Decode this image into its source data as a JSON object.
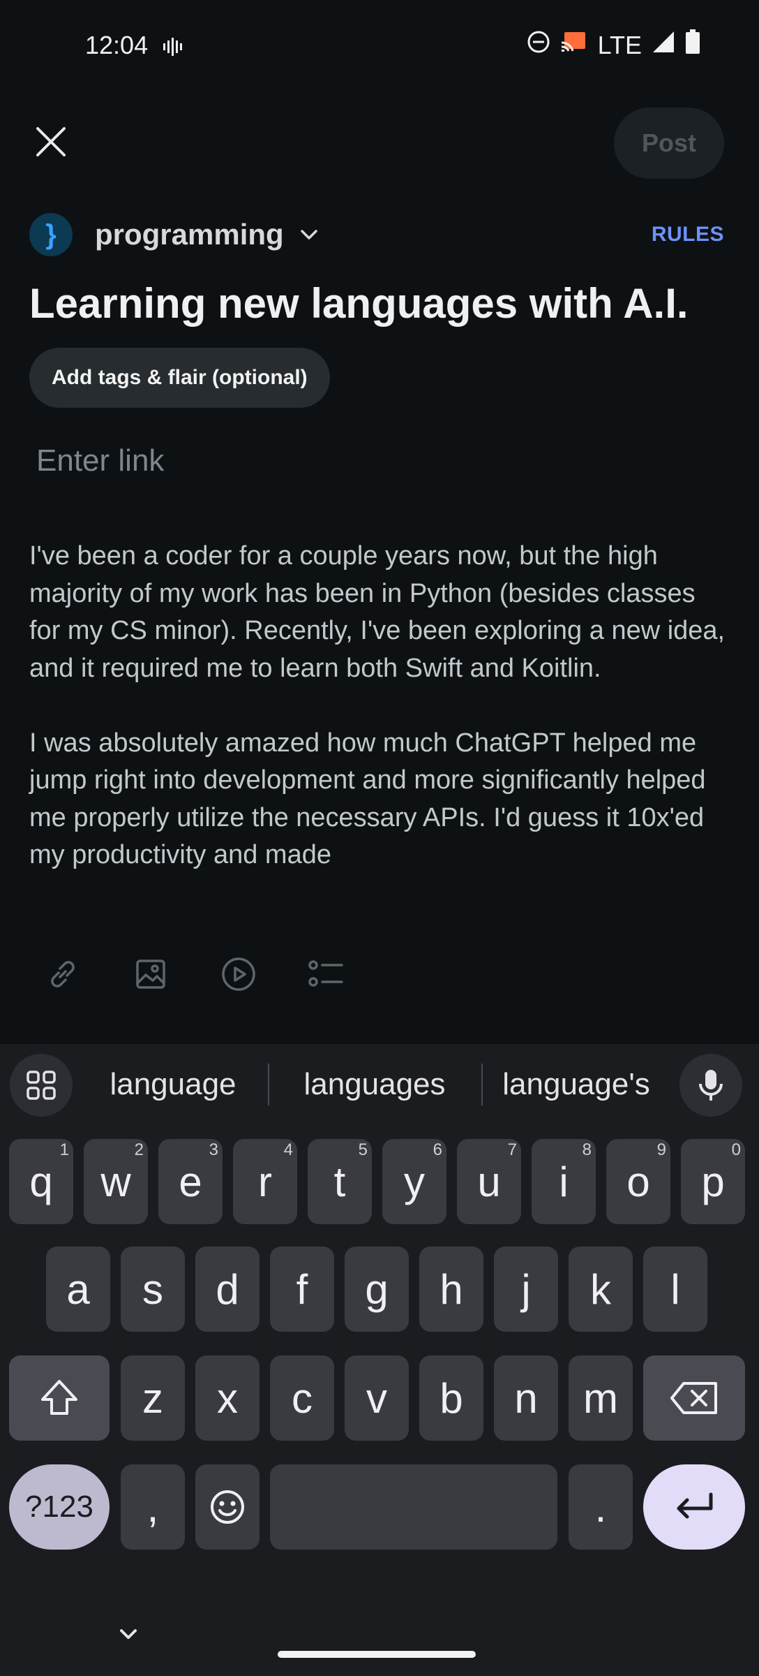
{
  "status_bar": {
    "time": "12:04",
    "network": "LTE",
    "icons": [
      "voicemail-icon",
      "do-not-disturb-icon",
      "cast-icon",
      "signal-icon",
      "battery-icon"
    ]
  },
  "header": {
    "close_icon": "close-icon",
    "post_label": "Post"
  },
  "community": {
    "avatar_glyph": "}",
    "name": "programming",
    "rules_label": "RULES"
  },
  "post": {
    "title": "Learning new languages with A.I.",
    "tags_label": "Add tags & flair (optional)",
    "link_placeholder": "Enter link",
    "body_paragraphs": [
      "I've been a coder for a couple years now, but the high majority of my work has been in Python (besides classes for my CS minor). Recently, I've been exploring a new idea, and it required me to learn both Swift and Koitlin.",
      "I was absolutely amazed how much ChatGPT helped me jump right into development and more significantly helped me properly utilize the necessary APIs. I'd guess it 10x'ed my productivity and made"
    ]
  },
  "toolbar": {
    "icons": [
      "link-icon",
      "image-icon",
      "video-icon",
      "list-icon"
    ]
  },
  "keyboard": {
    "suggestions": [
      "language",
      "languages",
      "language's"
    ],
    "row1": [
      {
        "k": "q",
        "h": "1"
      },
      {
        "k": "w",
        "h": "2"
      },
      {
        "k": "e",
        "h": "3"
      },
      {
        "k": "r",
        "h": "4"
      },
      {
        "k": "t",
        "h": "5"
      },
      {
        "k": "y",
        "h": "6"
      },
      {
        "k": "u",
        "h": "7"
      },
      {
        "k": "i",
        "h": "8"
      },
      {
        "k": "o",
        "h": "9"
      },
      {
        "k": "p",
        "h": "0"
      }
    ],
    "row2": [
      "a",
      "s",
      "d",
      "f",
      "g",
      "h",
      "j",
      "k",
      "l"
    ],
    "row3": [
      "z",
      "x",
      "c",
      "v",
      "b",
      "n",
      "m"
    ],
    "symbols_label": "?123",
    "comma_label": ",",
    "period_label": ".",
    "colors": {
      "key": "#3a3b40",
      "special": "#4a4b52",
      "accent": "#e2dcf8"
    }
  }
}
